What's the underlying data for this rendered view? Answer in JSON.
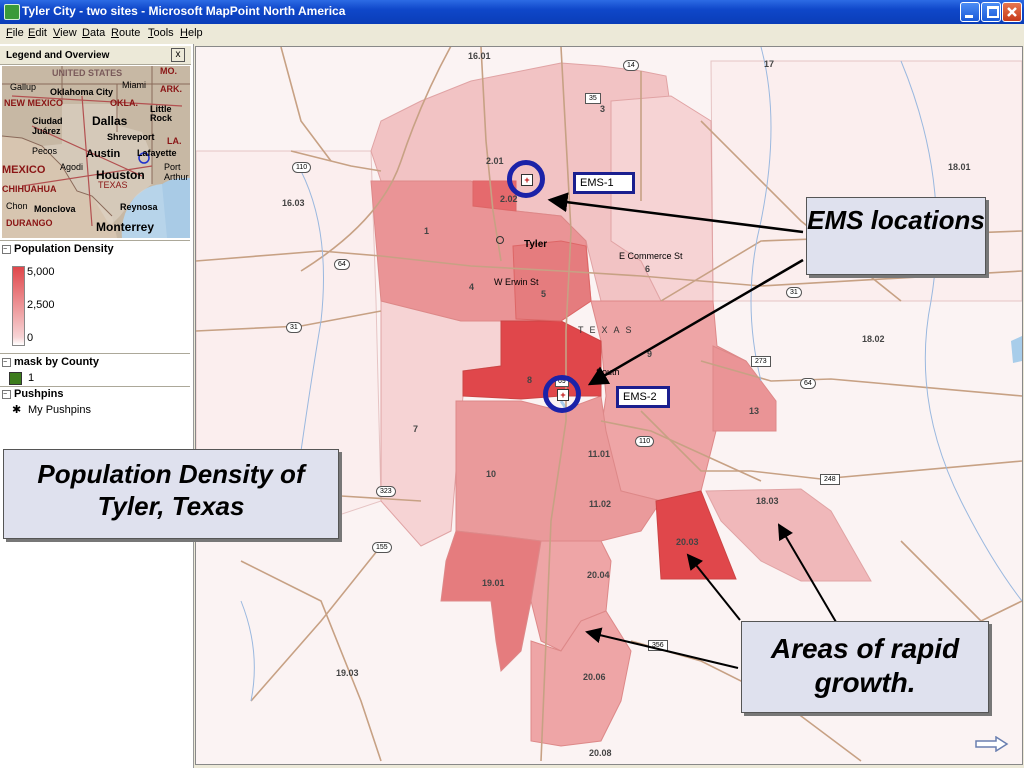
{
  "window": {
    "title": "Tyler City - two sites - Microsoft MapPoint North America"
  },
  "menu": [
    "File",
    "Edit",
    "View",
    "Data",
    "Route",
    "Tools",
    "Help"
  ],
  "legend_panel": {
    "title": "Legend and Overview",
    "close": "x",
    "overview_labels": [
      "UNITED STATES",
      "MO.",
      "Gallup",
      "Oklahoma City",
      "Miami",
      "ARK.",
      "NEW MEXICO",
      "OKLA.",
      "Little",
      "Rock",
      "Ciudad",
      "Juárez",
      "Dallas",
      "Shreveport",
      "LA.",
      "Pecos",
      "Austin",
      "Lafayette",
      "MEXICO",
      "Agodi",
      "Port",
      "Houston",
      "Arthur",
      "CHIHUAHUA",
      "TEXAS",
      "Chon",
      "Monclova",
      "Reynosa",
      "DURANGO",
      "Monterrey"
    ],
    "population_density": {
      "title": "Population Density",
      "scale": [
        "5,000",
        "2,500",
        "0"
      ]
    },
    "mask": {
      "title": "mask by County",
      "item": "1"
    },
    "pushpins": {
      "title": "Pushpins",
      "item": "My Pushpins"
    }
  },
  "map": {
    "tracts": [
      "16.01",
      "17",
      "2.01",
      "2.02",
      "3",
      "18.01",
      "16.03",
      "1",
      "4",
      "5",
      "6",
      "18.02",
      "8",
      "9",
      "7",
      "13",
      "11.01",
      "10",
      "11.02",
      "18.03",
      "20.03",
      "19.01",
      "20.04",
      "19.03",
      "20.06",
      "20.08"
    ],
    "streets": [
      "Tyler",
      "E Commerce St",
      "W Erwin St",
      "TEXAS",
      "South"
    ],
    "highways": [
      "14",
      "35",
      "110",
      "64",
      "31",
      "31",
      "273",
      "64",
      "110",
      "323",
      "155",
      "248",
      "356",
      "69"
    ],
    "ems_labels": [
      "EMS-1",
      "EMS-2"
    ],
    "colors": {
      "dark": "#e25a5c",
      "mid": "#ea8a8c",
      "light": "#f3bfc0",
      "pale": "#f9e2e2",
      "ring": "#1b22a8"
    }
  },
  "callouts": {
    "title": "Population Density of Tyler, Texas",
    "ems": "EMS locations",
    "growth": "Areas of rapid growth."
  }
}
